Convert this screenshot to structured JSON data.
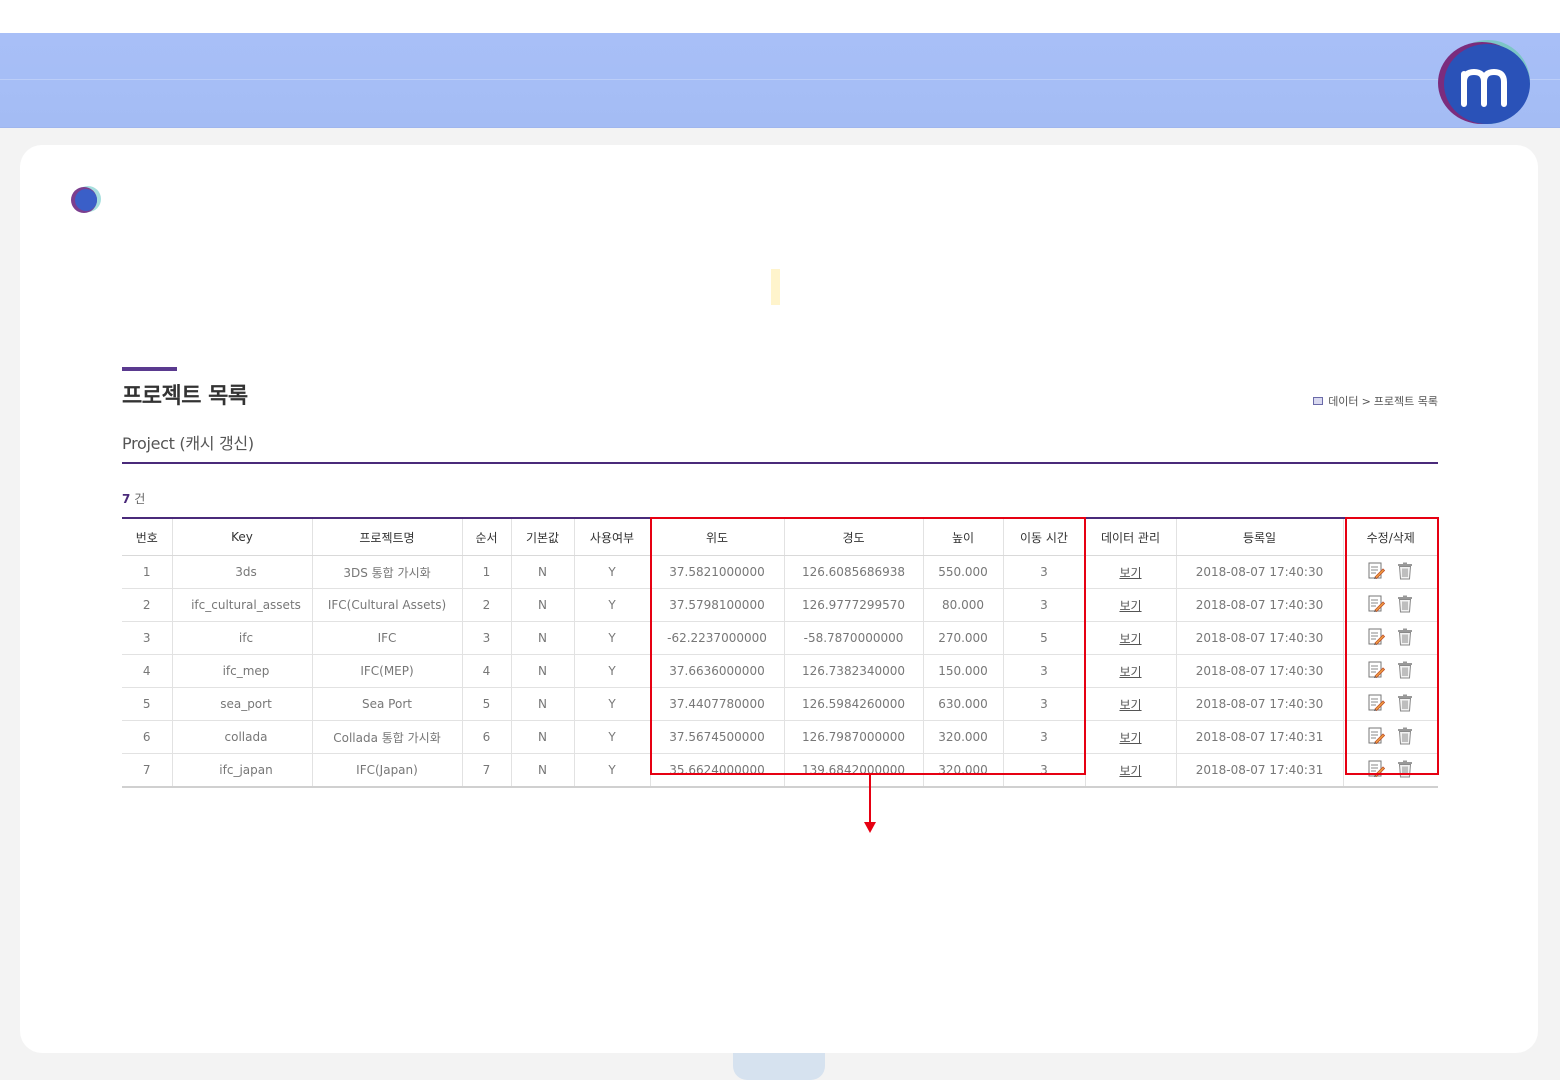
{
  "page": {
    "title": "프로젝트 목록",
    "subtitle": "Project (캐시 갱신)",
    "breadcrumb": {
      "parent": "데이터",
      "separator": ">",
      "current": "프로젝트 목록"
    },
    "count_value": "7",
    "count_unit": "건"
  },
  "table": {
    "headers": {
      "no": "번호",
      "key": "Key",
      "name": "프로젝트명",
      "order": "순서",
      "default": "기본값",
      "use": "사용여부",
      "lat": "위도",
      "lon": "경도",
      "height": "높이",
      "move_time": "이동 시간",
      "data_mgmt": "데이터 관리",
      "reg_date": "등록일",
      "edit_delete": "수정/삭제"
    },
    "rows": [
      {
        "no": "1",
        "key": "3ds",
        "name": "3DS 통합 가시화",
        "order": "1",
        "default": "N",
        "use": "Y",
        "lat": "37.5821000000",
        "lon": "126.6085686938",
        "height": "550.000",
        "move_time": "3",
        "view": "보기",
        "date": "2018-08-07 17:40:30"
      },
      {
        "no": "2",
        "key": "ifc_cultural_assets",
        "name": "IFC(Cultural Assets)",
        "order": "2",
        "default": "N",
        "use": "Y",
        "lat": "37.5798100000",
        "lon": "126.9777299570",
        "height": "80.000",
        "move_time": "3",
        "view": "보기",
        "date": "2018-08-07 17:40:30"
      },
      {
        "no": "3",
        "key": "ifc",
        "name": "IFC",
        "order": "3",
        "default": "N",
        "use": "Y",
        "lat": "-62.2237000000",
        "lon": "-58.7870000000",
        "height": "270.000",
        "move_time": "5",
        "view": "보기",
        "date": "2018-08-07 17:40:30"
      },
      {
        "no": "4",
        "key": "ifc_mep",
        "name": "IFC(MEP)",
        "order": "4",
        "default": "N",
        "use": "Y",
        "lat": "37.6636000000",
        "lon": "126.7382340000",
        "height": "150.000",
        "move_time": "3",
        "view": "보기",
        "date": "2018-08-07 17:40:30"
      },
      {
        "no": "5",
        "key": "sea_port",
        "name": "Sea Port",
        "order": "5",
        "default": "N",
        "use": "Y",
        "lat": "37.4407780000",
        "lon": "126.5984260000",
        "height": "630.000",
        "move_time": "3",
        "view": "보기",
        "date": "2018-08-07 17:40:30"
      },
      {
        "no": "6",
        "key": "collada",
        "name": "Collada 통합 가시화",
        "order": "6",
        "default": "N",
        "use": "Y",
        "lat": "37.5674500000",
        "lon": "126.7987000000",
        "height": "320.000",
        "move_time": "3",
        "view": "보기",
        "date": "2018-08-07 17:40:31"
      },
      {
        "no": "7",
        "key": "ifc_japan",
        "name": "IFC(Japan)",
        "order": "7",
        "default": "N",
        "use": "Y",
        "lat": "35.6624000000",
        "lon": "139.6842000000",
        "height": "320.000",
        "move_time": "3",
        "view": "보기",
        "date": "2018-08-07 17:40:31"
      }
    ]
  },
  "colors": {
    "accent": "#4a2a7a",
    "highlight": "#e60012",
    "banner": "#a6bef6"
  },
  "icons": [
    "logo-m-icon",
    "dot-logo-icon",
    "book-icon",
    "edit-icon",
    "trash-icon",
    "arrow-down-icon"
  ]
}
